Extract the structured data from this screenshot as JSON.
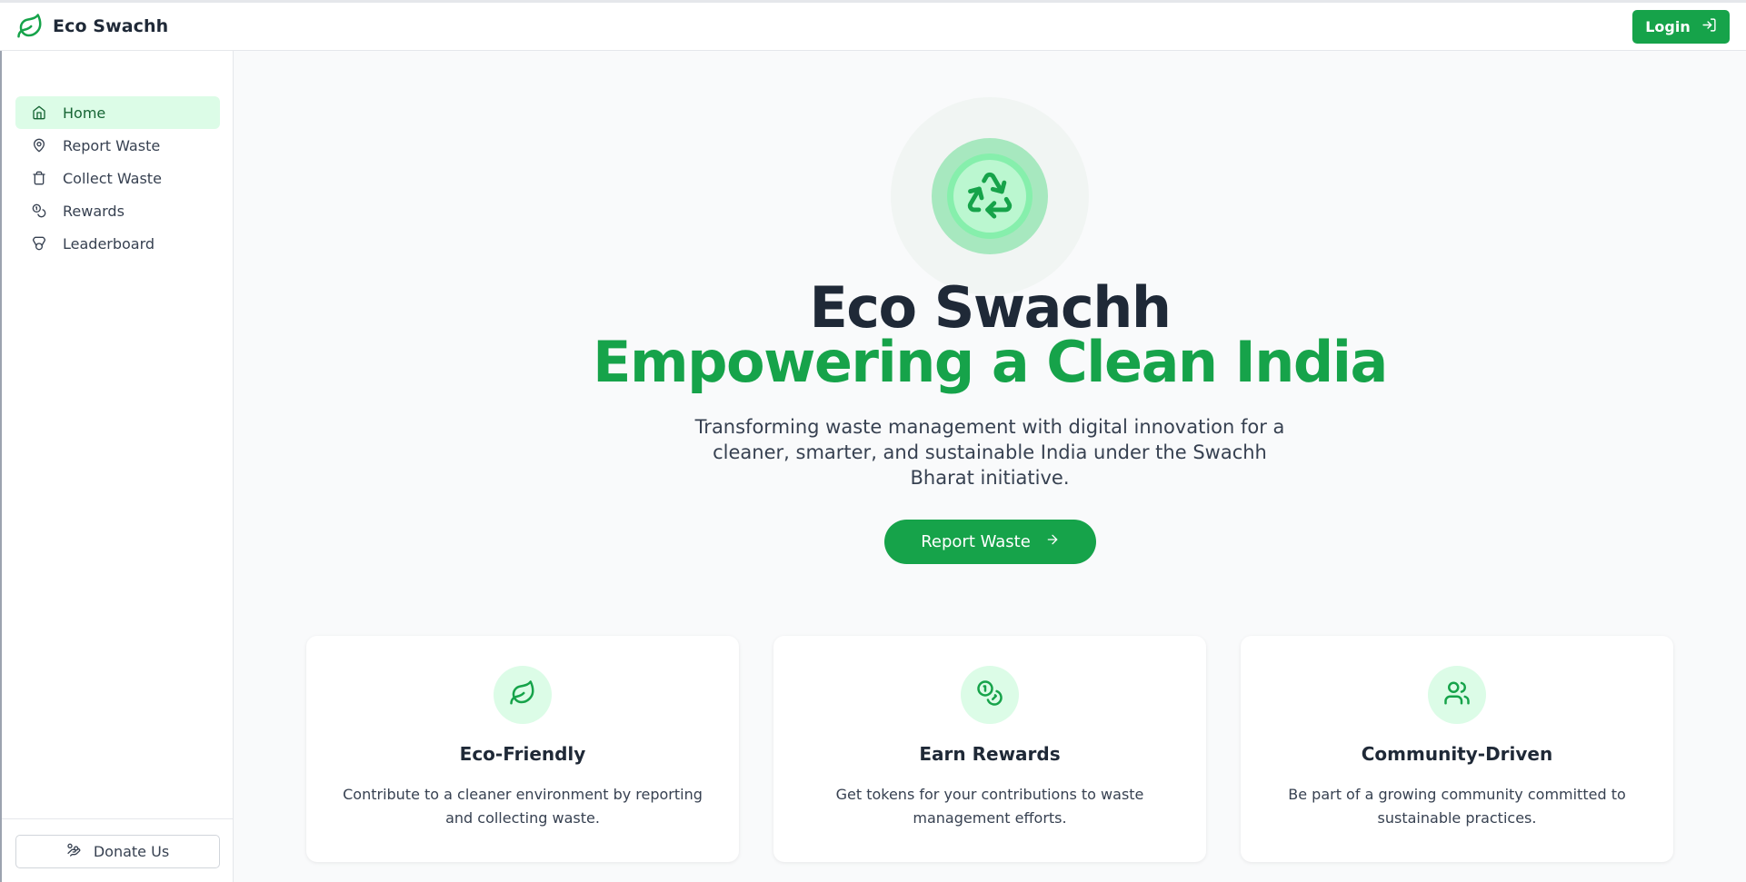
{
  "app": {
    "name": "Eco Swachh"
  },
  "header": {
    "login_label": "Login"
  },
  "sidebar": {
    "items": [
      {
        "label": "Home",
        "icon": "home-icon",
        "active": true
      },
      {
        "label": "Report Waste",
        "icon": "map-pin-icon",
        "active": false
      },
      {
        "label": "Collect Waste",
        "icon": "trash-icon",
        "active": false
      },
      {
        "label": "Rewards",
        "icon": "coins-icon",
        "active": false
      },
      {
        "label": "Leaderboard",
        "icon": "medal-icon",
        "active": false
      }
    ],
    "donate_label": "Donate Us"
  },
  "hero": {
    "title": "Eco Swachh",
    "subtitle": "Empowering a Clean India",
    "description": "Transforming waste management with digital innovation for a cleaner, smarter, and sustainable India under the Swachh Bharat initiative.",
    "cta_label": "Report Waste"
  },
  "features": [
    {
      "title": "Eco-Friendly",
      "description": "Contribute to a cleaner environment by reporting and collecting waste.",
      "icon": "leaf-icon"
    },
    {
      "title": "Earn Rewards",
      "description": "Get tokens for your contributions to waste management efforts.",
      "icon": "coins-icon"
    },
    {
      "title": "Community-Driven",
      "description": "Be part of a growing community committed to sustainable practices.",
      "icon": "users-icon"
    }
  ],
  "colors": {
    "brand": "#16a34a",
    "brand_light": "#dcfce7",
    "text_dark": "#1f2937"
  }
}
